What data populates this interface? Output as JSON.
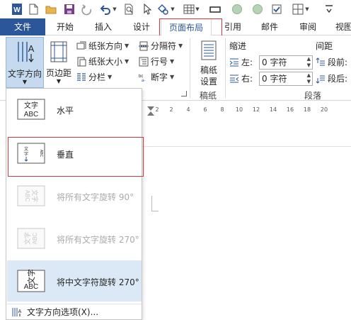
{
  "tabs": [
    "文件",
    "开始",
    "插入",
    "设计",
    "页面布局",
    "引用",
    "邮件",
    "审阅",
    "视图"
  ],
  "ribbon": {
    "text_direction": "文字方向",
    "margins": "页边距",
    "orientation": "纸张方向",
    "size": "纸张大小",
    "columns": "分栏",
    "breaks": "分隔符",
    "line_numbers": "行号",
    "hyphenation": "断字",
    "draft_paper_line1": "稿纸",
    "draft_paper_line2": "设置",
    "draft_group": "稿纸",
    "indent": {
      "title": "缩进",
      "left_label": "左:",
      "left_value": "0 字符",
      "right_label": "右:",
      "right_value": "0 字符"
    },
    "spacing": {
      "title": "间距",
      "before_label": "段前:",
      "after_label": "段后:"
    },
    "paragraph_group": "段落"
  },
  "ruler": {
    "ticks": [
      "2",
      "2",
      "4",
      "6",
      "8",
      "10",
      "12",
      "14",
      "16",
      "18",
      "20"
    ]
  },
  "dropdown": {
    "items": [
      {
        "label": "水平",
        "icon_text": "文字\nABC",
        "state": "normal"
      },
      {
        "label": "垂直",
        "icon_text": "文字ABC",
        "state": "normal"
      },
      {
        "label": "将所有文字旋转 90°",
        "icon_text": "文字ABC",
        "state": "disabled"
      },
      {
        "label": "将所有文字旋转 270°",
        "icon_text": "文字ABC",
        "state": "disabled"
      },
      {
        "label": "将中文字符旋转 270°",
        "icon_text": "文字\nABC",
        "state": "selected"
      }
    ],
    "options": "文字方向选项(X)..."
  },
  "colors": {
    "brand": "#2b579a",
    "highlight": "#d9363e",
    "selected": "#dbe8f5"
  },
  "icons": [
    "word-logo-icon",
    "new-doc-icon",
    "open-folder-icon",
    "save-icon",
    "redo-icon",
    "undo-icon",
    "print-preview-icon",
    "select-icon",
    "shapes-icon",
    "table-icon",
    "minimize-icon",
    "circle-icon",
    "circle-icon",
    "checkbox-icon",
    "grid-icon",
    "more-icon"
  ]
}
